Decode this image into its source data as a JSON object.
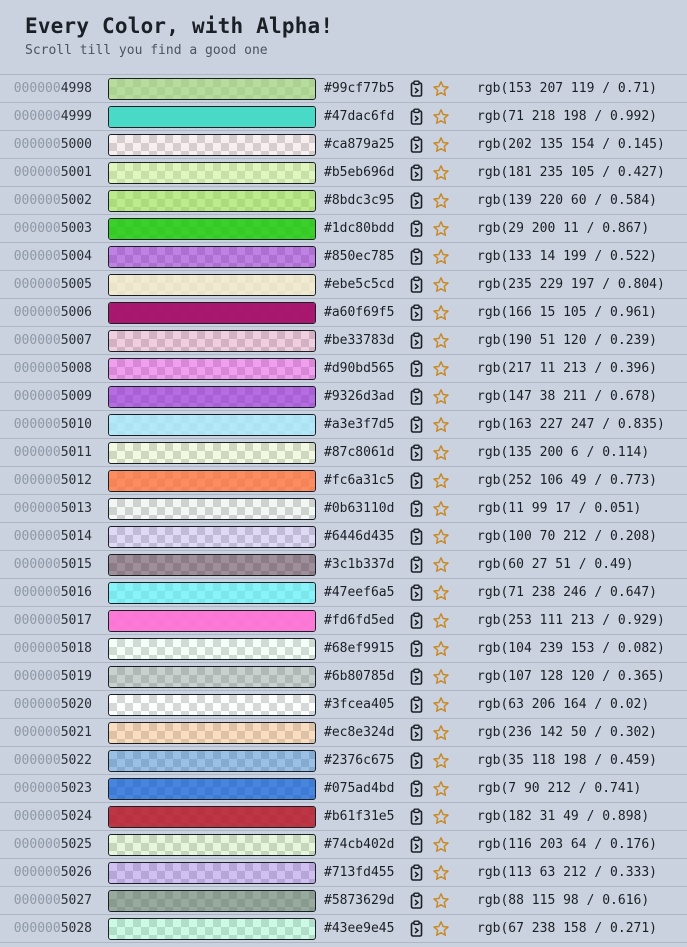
{
  "header": {
    "title": "Every Color, with Alpha!",
    "subtitle": "Scroll till you find a good one"
  },
  "icons": {
    "copy": "clipboard-copy-icon",
    "favorite": "star-outline-icon",
    "star_color": "#c98a2b"
  },
  "rows": [
    {
      "pad": "000000",
      "num": "4998",
      "hex": "#99cf77b5",
      "rgb": "rgb(153 207 119 / 0.71)",
      "color": "#99cf77",
      "alpha": 0.71
    },
    {
      "pad": "000000",
      "num": "4999",
      "hex": "#47dac6fd",
      "rgb": "rgb(71 218 198 / 0.992)",
      "color": "#47dac6",
      "alpha": 0.992
    },
    {
      "pad": "000000",
      "num": "5000",
      "hex": "#ca879a25",
      "rgb": "rgb(202 135 154 / 0.145)",
      "color": "#ca879a",
      "alpha": 0.145
    },
    {
      "pad": "000000",
      "num": "5001",
      "hex": "#b5eb696d",
      "rgb": "rgb(181 235 105 / 0.427)",
      "color": "#b5eb69",
      "alpha": 0.427
    },
    {
      "pad": "000000",
      "num": "5002",
      "hex": "#8bdc3c95",
      "rgb": "rgb(139 220 60 / 0.584)",
      "color": "#8bdc3c",
      "alpha": 0.584
    },
    {
      "pad": "000000",
      "num": "5003",
      "hex": "#1dc80bdd",
      "rgb": "rgb(29 200 11 / 0.867)",
      "color": "#1dc80b",
      "alpha": 0.867
    },
    {
      "pad": "000000",
      "num": "5004",
      "hex": "#850ec785",
      "rgb": "rgb(133 14 199 / 0.522)",
      "color": "#850ec7",
      "alpha": 0.522
    },
    {
      "pad": "000000",
      "num": "5005",
      "hex": "#ebe5c5cd",
      "rgb": "rgb(235 229 197 / 0.804)",
      "color": "#ebe5c5",
      "alpha": 0.804
    },
    {
      "pad": "000000",
      "num": "5006",
      "hex": "#a60f69f5",
      "rgb": "rgb(166 15 105 / 0.961)",
      "color": "#a60f69",
      "alpha": 0.961
    },
    {
      "pad": "000000",
      "num": "5007",
      "hex": "#be33783d",
      "rgb": "rgb(190 51 120 / 0.239)",
      "color": "#be3378",
      "alpha": 0.239
    },
    {
      "pad": "000000",
      "num": "5008",
      "hex": "#d90bd565",
      "rgb": "rgb(217 11 213 / 0.396)",
      "color": "#d90bd5",
      "alpha": 0.396
    },
    {
      "pad": "000000",
      "num": "5009",
      "hex": "#9326d3ad",
      "rgb": "rgb(147 38 211 / 0.678)",
      "color": "#9326d3",
      "alpha": 0.678
    },
    {
      "pad": "000000",
      "num": "5010",
      "hex": "#a3e3f7d5",
      "rgb": "rgb(163 227 247 / 0.835)",
      "color": "#a3e3f7",
      "alpha": 0.835
    },
    {
      "pad": "000000",
      "num": "5011",
      "hex": "#87c8061d",
      "rgb": "rgb(135 200 6 / 0.114)",
      "color": "#87c806",
      "alpha": 0.114
    },
    {
      "pad": "000000",
      "num": "5012",
      "hex": "#fc6a31c5",
      "rgb": "rgb(252 106 49 / 0.773)",
      "color": "#fc6a31",
      "alpha": 0.773
    },
    {
      "pad": "000000",
      "num": "5013",
      "hex": "#0b63110d",
      "rgb": "rgb(11 99 17 / 0.051)",
      "color": "#0b6311",
      "alpha": 0.051
    },
    {
      "pad": "000000",
      "num": "5014",
      "hex": "#6446d435",
      "rgb": "rgb(100 70 212 / 0.208)",
      "color": "#6446d4",
      "alpha": 0.208
    },
    {
      "pad": "000000",
      "num": "5015",
      "hex": "#3c1b337d",
      "rgb": "rgb(60 27 51 / 0.49)",
      "color": "#3c1b33",
      "alpha": 0.49
    },
    {
      "pad": "000000",
      "num": "5016",
      "hex": "#47eef6a5",
      "rgb": "rgb(71 238 246 / 0.647)",
      "color": "#47eef6",
      "alpha": 0.647
    },
    {
      "pad": "000000",
      "num": "5017",
      "hex": "#fd6fd5ed",
      "rgb": "rgb(253 111 213 / 0.929)",
      "color": "#fd6fd5",
      "alpha": 0.929
    },
    {
      "pad": "000000",
      "num": "5018",
      "hex": "#68ef9915",
      "rgb": "rgb(104 239 153 / 0.082)",
      "color": "#68ef99",
      "alpha": 0.082
    },
    {
      "pad": "000000",
      "num": "5019",
      "hex": "#6b80785d",
      "rgb": "rgb(107 128 120 / 0.365)",
      "color": "#6b8078",
      "alpha": 0.365
    },
    {
      "pad": "000000",
      "num": "5020",
      "hex": "#3fcea405",
      "rgb": "rgb(63 206 164 / 0.02)",
      "color": "#3fcea4",
      "alpha": 0.02
    },
    {
      "pad": "000000",
      "num": "5021",
      "hex": "#ec8e324d",
      "rgb": "rgb(236 142 50 / 0.302)",
      "color": "#ec8e32",
      "alpha": 0.302
    },
    {
      "pad": "000000",
      "num": "5022",
      "hex": "#2376c675",
      "rgb": "rgb(35 118 198 / 0.459)",
      "color": "#2376c6",
      "alpha": 0.459
    },
    {
      "pad": "000000",
      "num": "5023",
      "hex": "#075ad4bd",
      "rgb": "rgb(7 90 212 / 0.741)",
      "color": "#075ad4",
      "alpha": 0.741
    },
    {
      "pad": "000000",
      "num": "5024",
      "hex": "#b61f31e5",
      "rgb": "rgb(182 31 49 / 0.898)",
      "color": "#b61f31",
      "alpha": 0.898
    },
    {
      "pad": "000000",
      "num": "5025",
      "hex": "#74cb402d",
      "rgb": "rgb(116 203 64 / 0.176)",
      "color": "#74cb40",
      "alpha": 0.176
    },
    {
      "pad": "000000",
      "num": "5026",
      "hex": "#713fd455",
      "rgb": "rgb(113 63 212 / 0.333)",
      "color": "#713fd4",
      "alpha": 0.333
    },
    {
      "pad": "000000",
      "num": "5027",
      "hex": "#5873629d",
      "rgb": "rgb(88 115 98 / 0.616)",
      "color": "#587362",
      "alpha": 0.616
    },
    {
      "pad": "000000",
      "num": "5028",
      "hex": "#43ee9e45",
      "rgb": "rgb(67 238 158 / 0.271)",
      "color": "#43ee9e",
      "alpha": 0.271
    }
  ]
}
